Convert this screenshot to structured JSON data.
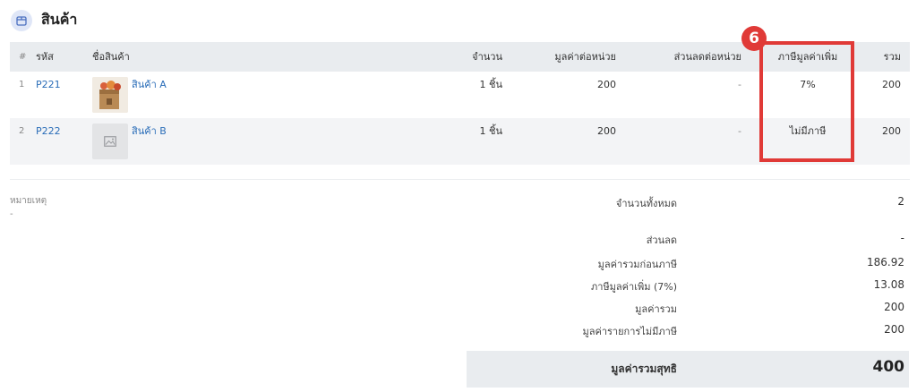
{
  "section": {
    "title": "สินค้า",
    "icon": "store-icon"
  },
  "table": {
    "headers": {
      "idx": "#",
      "code": "รหัส",
      "name": "ชื่อสินค้า",
      "qty": "จำนวน",
      "unit_price": "มูลค่าต่อหน่วย",
      "discount": "ส่วนลดต่อหน่วย",
      "vat": "ภาษีมูลค่าเพิ่ม",
      "total": "รวม"
    },
    "rows": [
      {
        "idx": "1",
        "code": "P221",
        "name": "สินค้า A",
        "qty": "1 ชิ้น",
        "unit_price": "200",
        "discount": "-",
        "vat": "7%",
        "total": "200",
        "image": "product-photo-icon"
      },
      {
        "idx": "2",
        "code": "P222",
        "name": "สินค้า B",
        "qty": "1 ชิ้น",
        "unit_price": "200",
        "discount": "-",
        "vat": "ไม่มีภาษี",
        "total": "200",
        "image": "image-placeholder-icon"
      }
    ]
  },
  "highlight": {
    "step": "6",
    "color": "#e03a37"
  },
  "note": {
    "label": "หมายเหตุ",
    "value": "-"
  },
  "summary": {
    "total_qty_label": "จำนวนทั้งหมด",
    "total_qty_value": "2",
    "discount_label": "ส่วนลด",
    "discount_value": "-",
    "pre_tax_label": "มูลค่ารวมก่อนภาษี",
    "pre_tax_value": "186.92",
    "vat_label": "ภาษีมูลค่าเพิ่ม (7%)",
    "vat_value": "13.08",
    "total_label": "มูลค่ารวม",
    "total_value": "200",
    "non_vat_label": "มูลค่ารายการไม่มีภาษี",
    "non_vat_value": "200",
    "net_label": "มูลค่ารวมสุทธิ",
    "net_value": "400"
  }
}
